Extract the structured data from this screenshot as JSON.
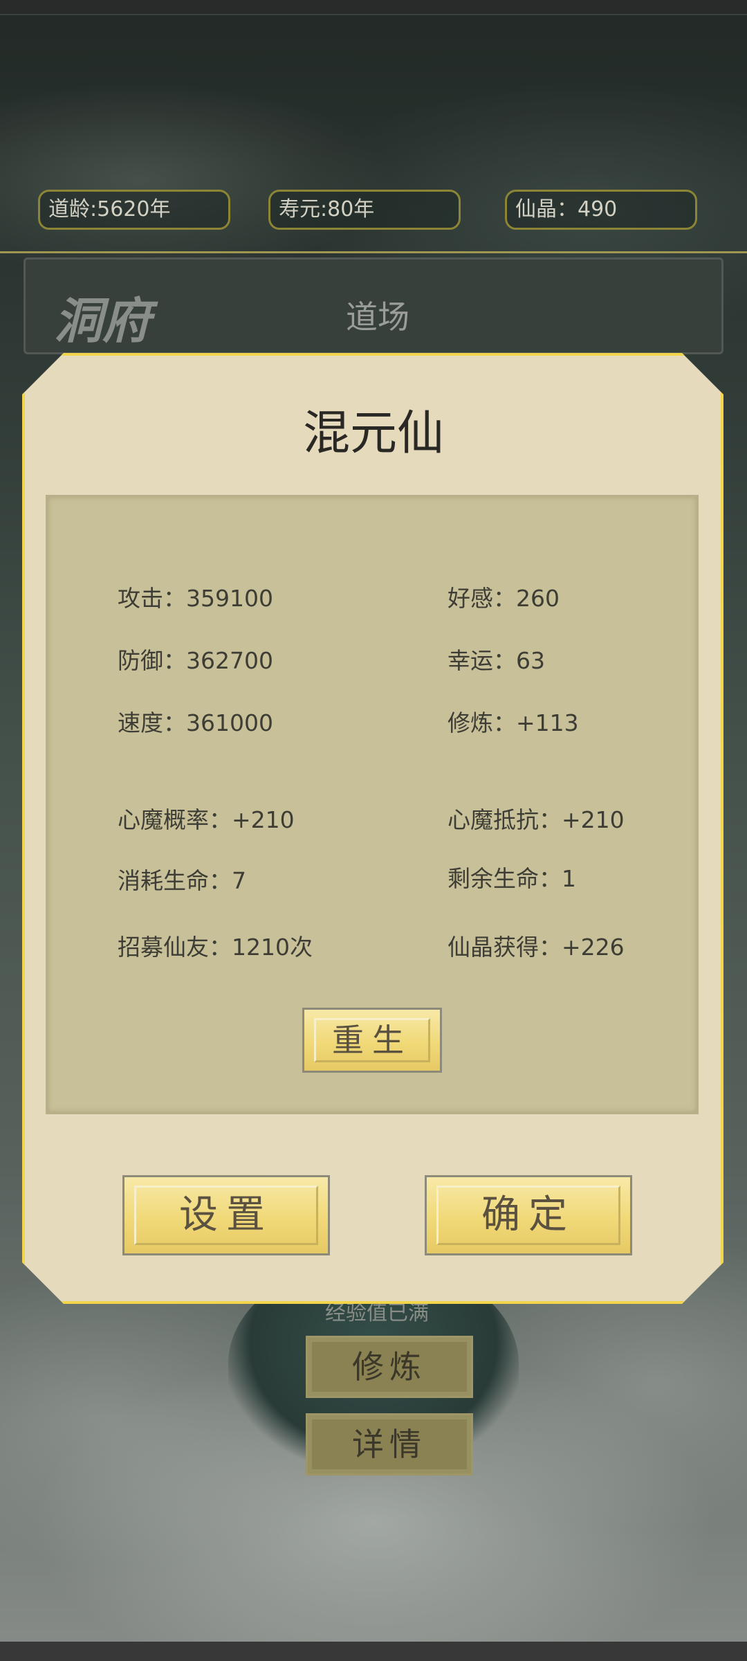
{
  "status_bar": {
    "age": "道龄:5620年",
    "lifespan": "寿元:80年",
    "crystal": "仙晶：490"
  },
  "cave": {
    "logo": "洞府",
    "tab": "道场"
  },
  "background": {
    "exp_text": "经验值已满",
    "train_button": "修炼",
    "detail_button": "详情"
  },
  "dialog": {
    "title": "混元仙",
    "stats": {
      "attack": "攻击：359100",
      "favor": "好感：260",
      "defense": "防御：362700",
      "luck": "幸运：63",
      "speed": "速度：361000",
      "cultivation": "修炼：+113",
      "demon_rate": "心魔概率：+210",
      "demon_resist": "心魔抵抗：+210",
      "life_used": "消耗生命：7",
      "life_left": "剩余生命：1",
      "recruit": "招募仙友：1210次",
      "crystal_gain": "仙晶获得：+226"
    },
    "rebirth_button": "重生",
    "settings_button": "设置",
    "confirm_button": "确定"
  },
  "colors": {
    "dialog_bg": "#e6dabd",
    "dialog_border": "#f2d54b",
    "panel_bg": "#c7c098",
    "button_gold": "#f1d978"
  }
}
